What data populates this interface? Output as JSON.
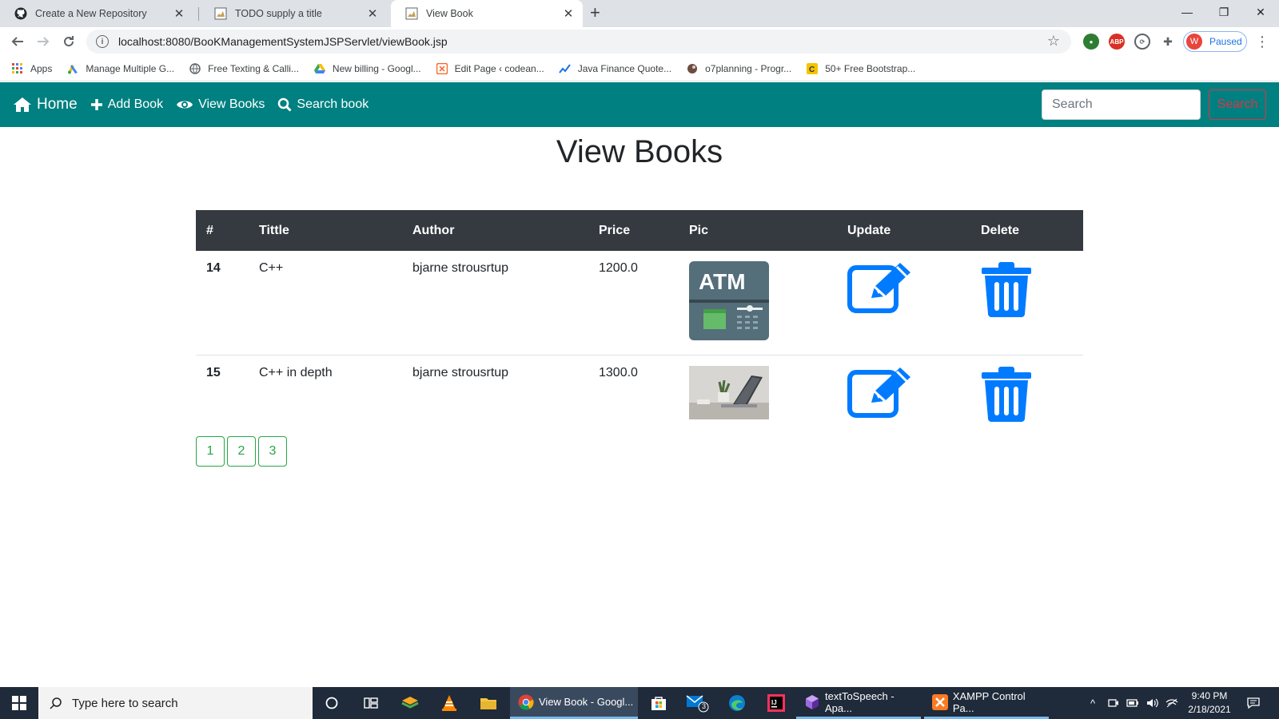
{
  "browser": {
    "tabs": [
      {
        "title": "Create a New Repository",
        "icon": "github-icon"
      },
      {
        "title": "TODO supply a title",
        "icon": "page-icon"
      },
      {
        "title": "View Book",
        "icon": "page-icon",
        "active": true
      }
    ],
    "url": "localhost:8080/BooKManagementSystemJSPServlet/viewBook.jsp",
    "profile_initial": "W",
    "profile_status": "Paused",
    "bookmarks": [
      {
        "label": "Apps",
        "icon": "apps-grid-icon"
      },
      {
        "label": "Manage Multiple G...",
        "icon": "google-ads-icon"
      },
      {
        "label": "Free Texting & Calli...",
        "icon": "globe-icon"
      },
      {
        "label": "New billing - Googl...",
        "icon": "google-drive-icon"
      },
      {
        "label": "Edit Page ‹ codean...",
        "icon": "codeanywhere-icon"
      },
      {
        "label": "Java Finance Quote...",
        "icon": "chart-trend-icon"
      },
      {
        "label": "o7planning - Progr...",
        "icon": "o7planning-icon"
      },
      {
        "label": "50+ Free Bootstrap...",
        "icon": "bootstrap-c-icon"
      }
    ]
  },
  "nav": {
    "home": "Home",
    "add_book": "Add Book",
    "view_books": "View Books",
    "search_book": "Search book",
    "search_placeholder": "Search",
    "search_button": "Search",
    "brand_color": "#008080"
  },
  "page": {
    "title": "View Books"
  },
  "table": {
    "headers": [
      "#",
      "Tittle",
      "Author",
      "Price",
      "Pic",
      "Update",
      "Delete"
    ],
    "rows": [
      {
        "id": "14",
        "title": "C++",
        "author": "bjarne strousrtup",
        "price": "1200.0",
        "pic": "atm-image"
      },
      {
        "id": "15",
        "title": "C++ in depth",
        "author": "bjarne strousrtup",
        "price": "1300.0",
        "pic": "laptop-desk-image"
      }
    ]
  },
  "pagination": [
    "1",
    "2",
    "3"
  ],
  "taskbar": {
    "search_placeholder": "Type here to search",
    "apps": [
      {
        "label": "View Book - Googl...",
        "icon": "chrome-icon"
      },
      {
        "label": "textToSpeech - Apa...",
        "icon": "netbeans-icon"
      },
      {
        "label": "XAMPP Control Pa...",
        "icon": "xampp-icon"
      }
    ],
    "mail_badge": "3",
    "time": "9:40 PM",
    "date": "2/18/2021"
  }
}
